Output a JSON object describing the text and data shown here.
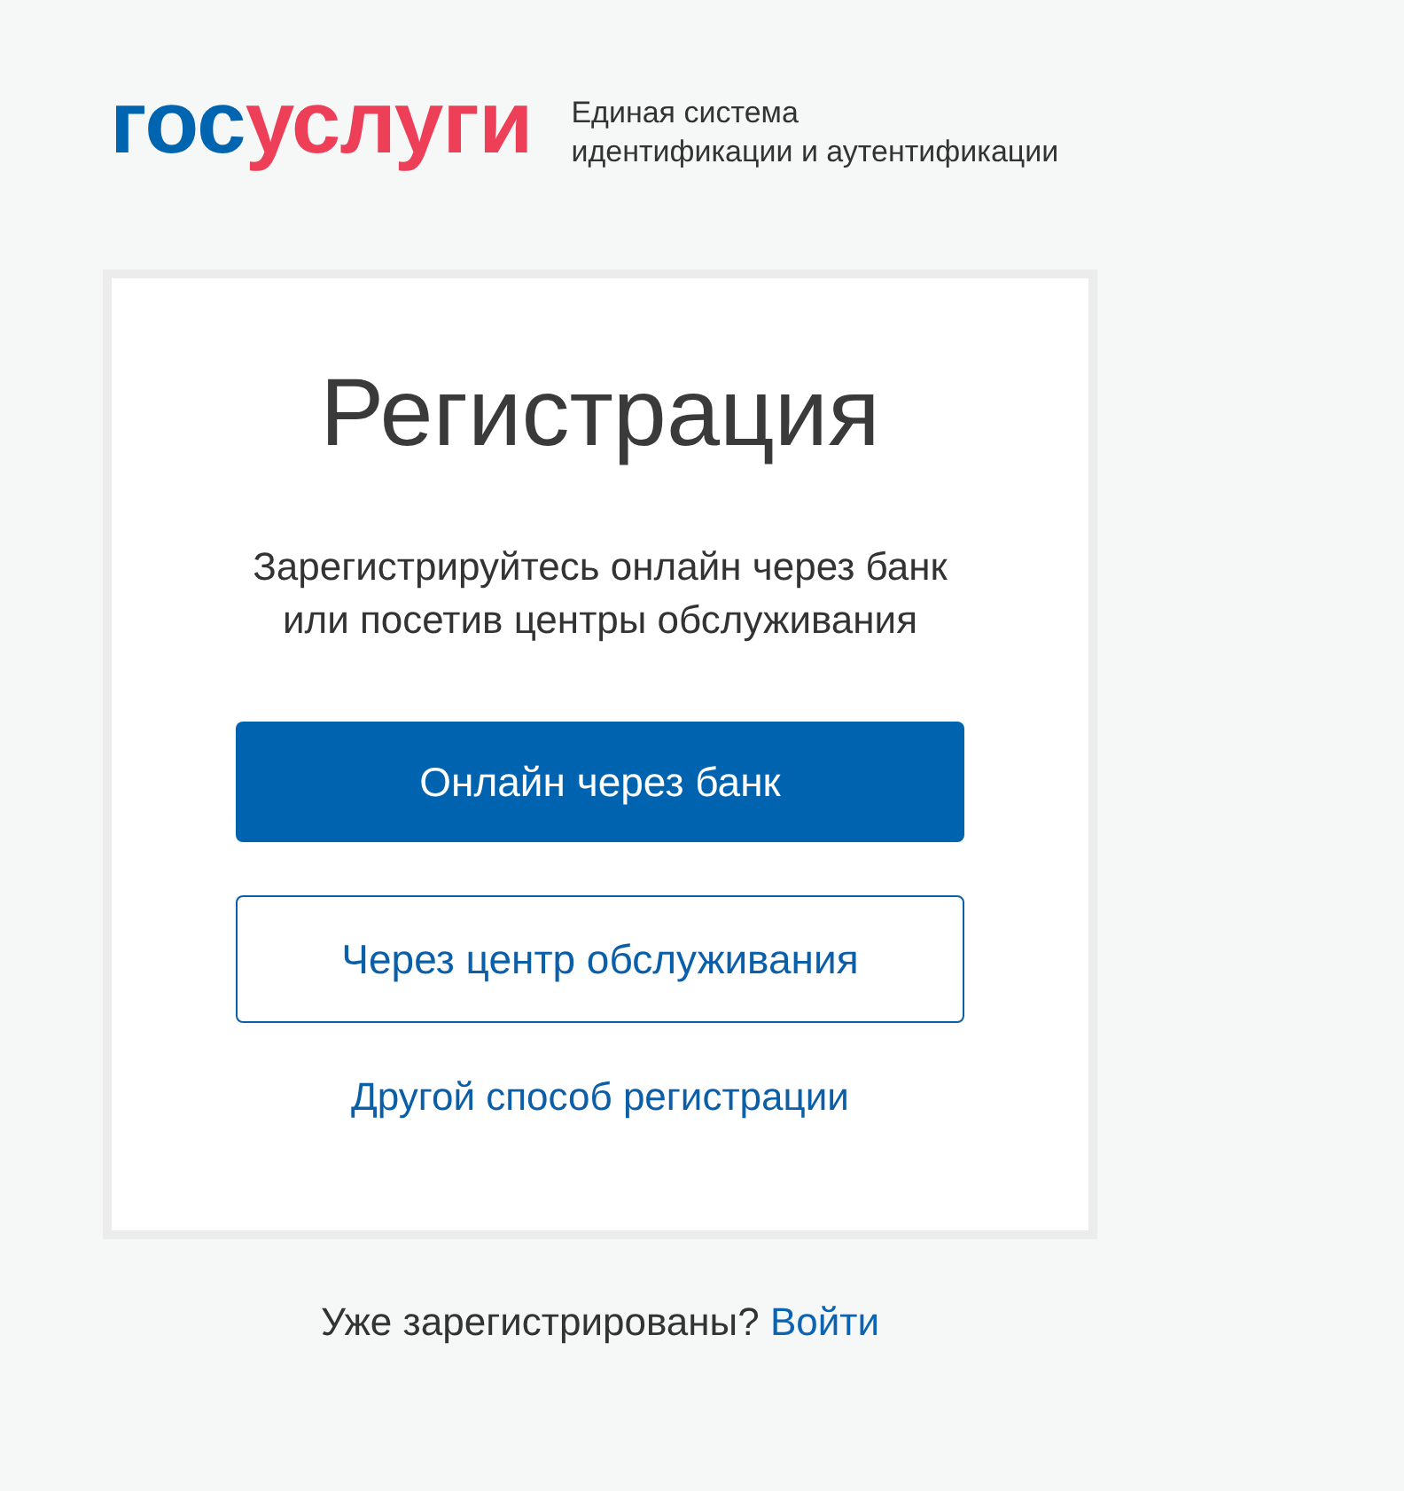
{
  "header": {
    "logo": {
      "part_1": "гос",
      "part_2": "услуги"
    },
    "tagline": [
      "Единая система",
      "идентификации и аутентификации"
    ]
  },
  "card": {
    "title": "Регистрация",
    "description": "Зарегистрируйтесь онлайн через банк или посетив центры обслуживания",
    "buttons": [
      {
        "label": "Онлайн через банк",
        "kind": "primary"
      },
      {
        "label": "Через центр обслуживания",
        "kind": "secondary"
      }
    ],
    "link": "Другой способ регистрации"
  },
  "footer": {
    "text": "Уже зарегистрированы?",
    "link": "Войти"
  }
}
